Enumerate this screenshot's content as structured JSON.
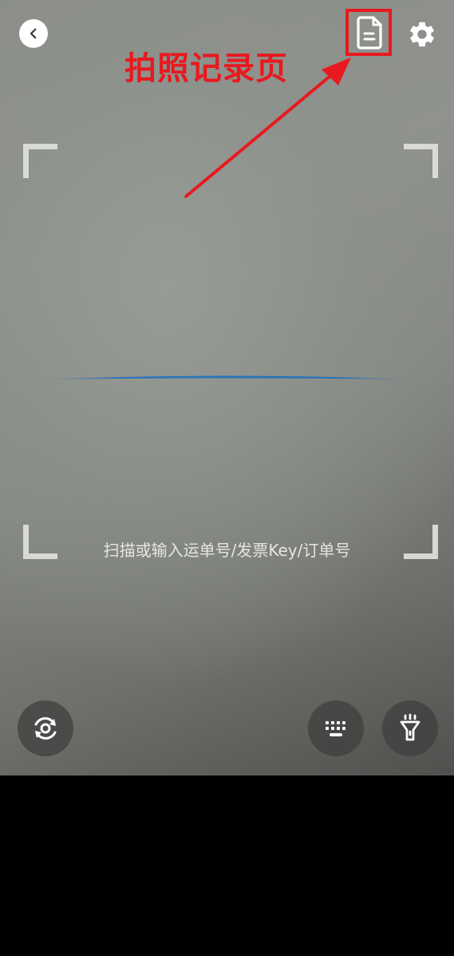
{
  "annotation": {
    "label": "拍照记录页",
    "color": "#e8191f"
  },
  "top_bar": {
    "back_icon": "chevron-left-icon",
    "record_icon": "document-icon",
    "settings_icon": "gear-icon"
  },
  "scanner": {
    "hint": "扫描或输入运单号/发票Key/订单号",
    "scan_line_color": "#1f6fbf"
  },
  "bottom_controls": {
    "switch_camera_icon": "camera-switch-icon",
    "keyboard_icon": "keyboard-icon",
    "flashlight_icon": "flashlight-icon"
  }
}
